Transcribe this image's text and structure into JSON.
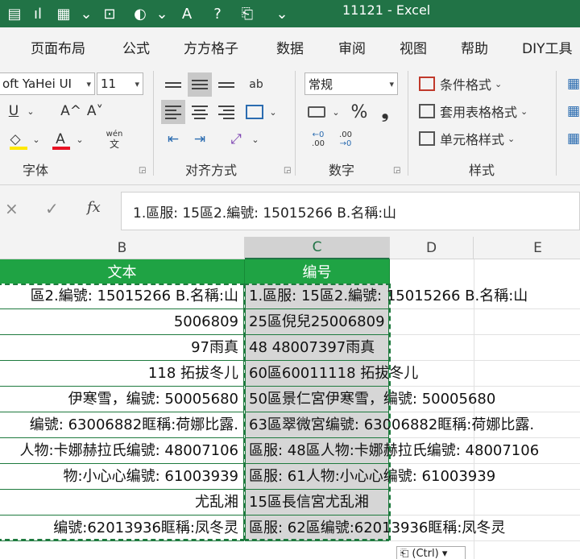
{
  "window": {
    "title": "11121 - Excel"
  },
  "quick_access": [
    {
      "name": "save-icon",
      "glyph": "▤"
    },
    {
      "name": "chart-icon",
      "glyph": "ıl"
    },
    {
      "name": "table-icon",
      "glyph": "▦"
    },
    {
      "name": "chevron-down-icon",
      "glyph": "⌄"
    },
    {
      "name": "camera-icon",
      "glyph": "⊡"
    },
    {
      "name": "shapes-icon",
      "glyph": "◐"
    },
    {
      "name": "chevron-down-icon",
      "glyph": "⌄"
    },
    {
      "name": "text-box-icon",
      "glyph": "A"
    },
    {
      "name": "help-icon",
      "glyph": "?"
    },
    {
      "name": "clipboard-icon",
      "glyph": "⎗"
    },
    {
      "name": "customize-icon",
      "glyph": "⌄"
    }
  ],
  "tabs": [
    "页面布局",
    "公式",
    "方方格子",
    "数据",
    "审阅",
    "视图",
    "帮助",
    "DIY工具"
  ],
  "ribbon": {
    "font": {
      "name": "oft YaHei UI",
      "size": "11",
      "underline": "U",
      "grow": "A^",
      "shrink": "A˅",
      "wen_top": "wén",
      "wen_bottom": "文",
      "label": "字体"
    },
    "alignment": {
      "label": "对齐方式",
      "wrap_icon": "ab"
    },
    "number": {
      "format": "常规",
      "percent": "%",
      "comma": "❟",
      "inc_decimal": ".00",
      "dec_decimal": ".00",
      "label": "数字"
    },
    "styles": {
      "conditional": "条件格式",
      "table": "套用表格格式",
      "cell": "单元格样式",
      "label": "样式"
    }
  },
  "formula_bar": {
    "cancel": "×",
    "enter": "✓",
    "fx": "fx",
    "content": "1.區服: 15區2.編號: 15015266 B.名稱:山"
  },
  "grid": {
    "columns": [
      "B",
      "C",
      "D",
      "E"
    ],
    "header_b": "文本",
    "header_c": "编号",
    "rows": [
      {
        "b": "區2.編號: 15015266 B.名稱:山",
        "c": "1.區服: 15區2.編號: 15015266 B.名稱:山"
      },
      {
        "b": "5006809",
        "c": "25區倪兒25006809"
      },
      {
        "b": "97雨真",
        "c": "48 48007397雨真"
      },
      {
        "b": "118 拓拔冬儿",
        "c": "60區60011118 拓拔冬儿"
      },
      {
        "b": "伊寒雪，编號: 50005680",
        "c": "50區景仁宮伊寒雪，编號: 50005680"
      },
      {
        "b": "编號: 63006882眶稱:荷娜比露.",
        "c": "63區翠微宮编號: 63006882眶稱:荷娜比露."
      },
      {
        "b": "人物:卡娜赫拉氏编號: 48007106",
        "c": "區服: 48區人物:卡娜赫拉氏编號: 48007106"
      },
      {
        "b": "物:小心心编號: 61003939",
        "c": "區服: 61人物:小心心编號: 61003939"
      },
      {
        "b": "尤乱湘",
        "c": "15區長信宮尤乱湘"
      },
      {
        "b": "编號:62013936眶稱:凤冬灵",
        "c": "區服: 62區编號:62013936眶稱:凤冬灵"
      }
    ],
    "paste_options": "(Ctrl) ▾"
  }
}
